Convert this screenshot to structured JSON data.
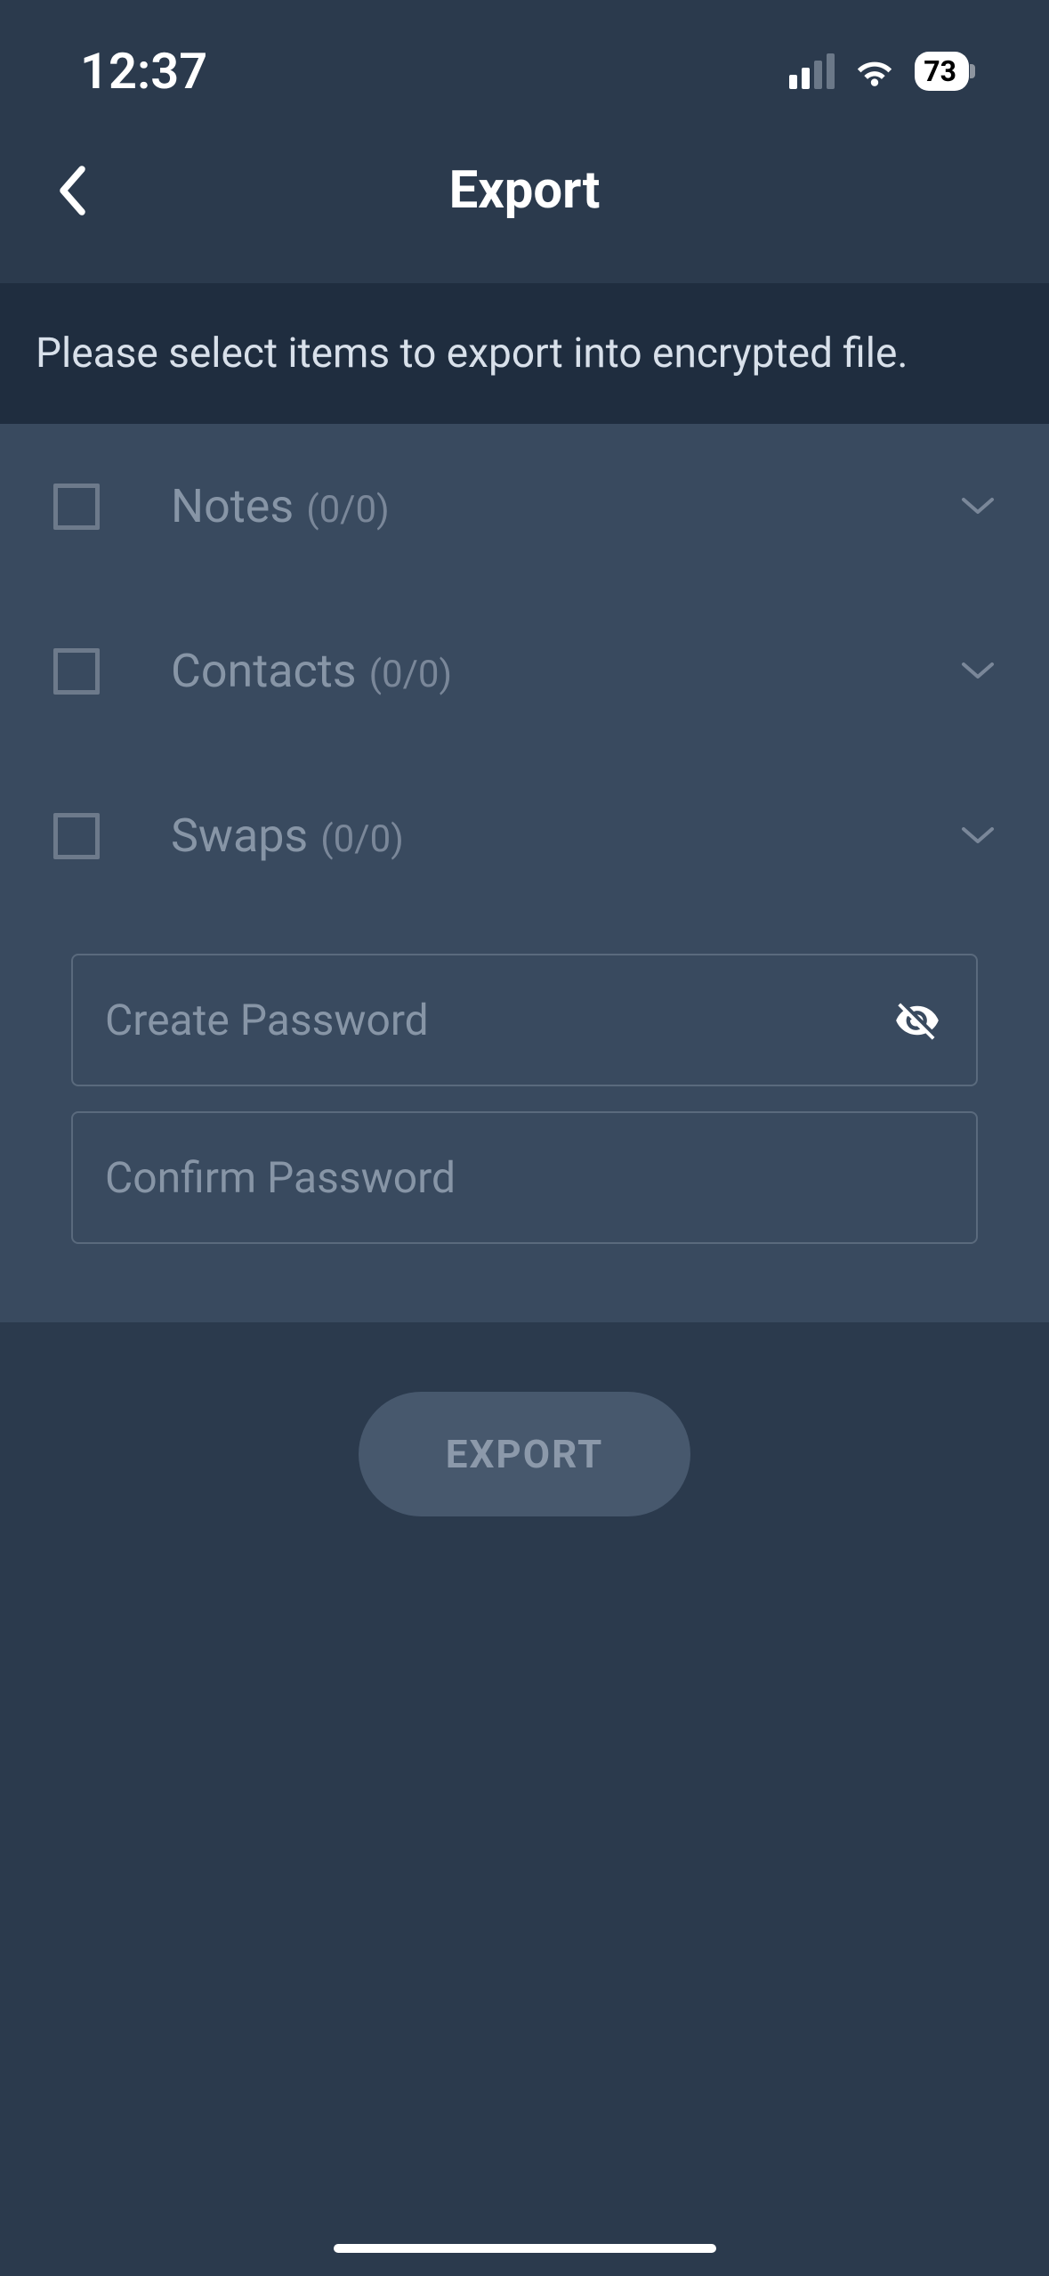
{
  "status": {
    "time": "12:37",
    "battery": "73"
  },
  "nav": {
    "title": "Export"
  },
  "instruction": "Please select items to export into encrypted file.",
  "items": [
    {
      "label": "Notes",
      "count": "(0/0)"
    },
    {
      "label": "Contacts",
      "count": "(0/0)"
    },
    {
      "label": "Swaps",
      "count": "(0/0)"
    }
  ],
  "password": {
    "create_placeholder": "Create Password",
    "confirm_placeholder": "Confirm Password"
  },
  "export_button": "EXPORT"
}
